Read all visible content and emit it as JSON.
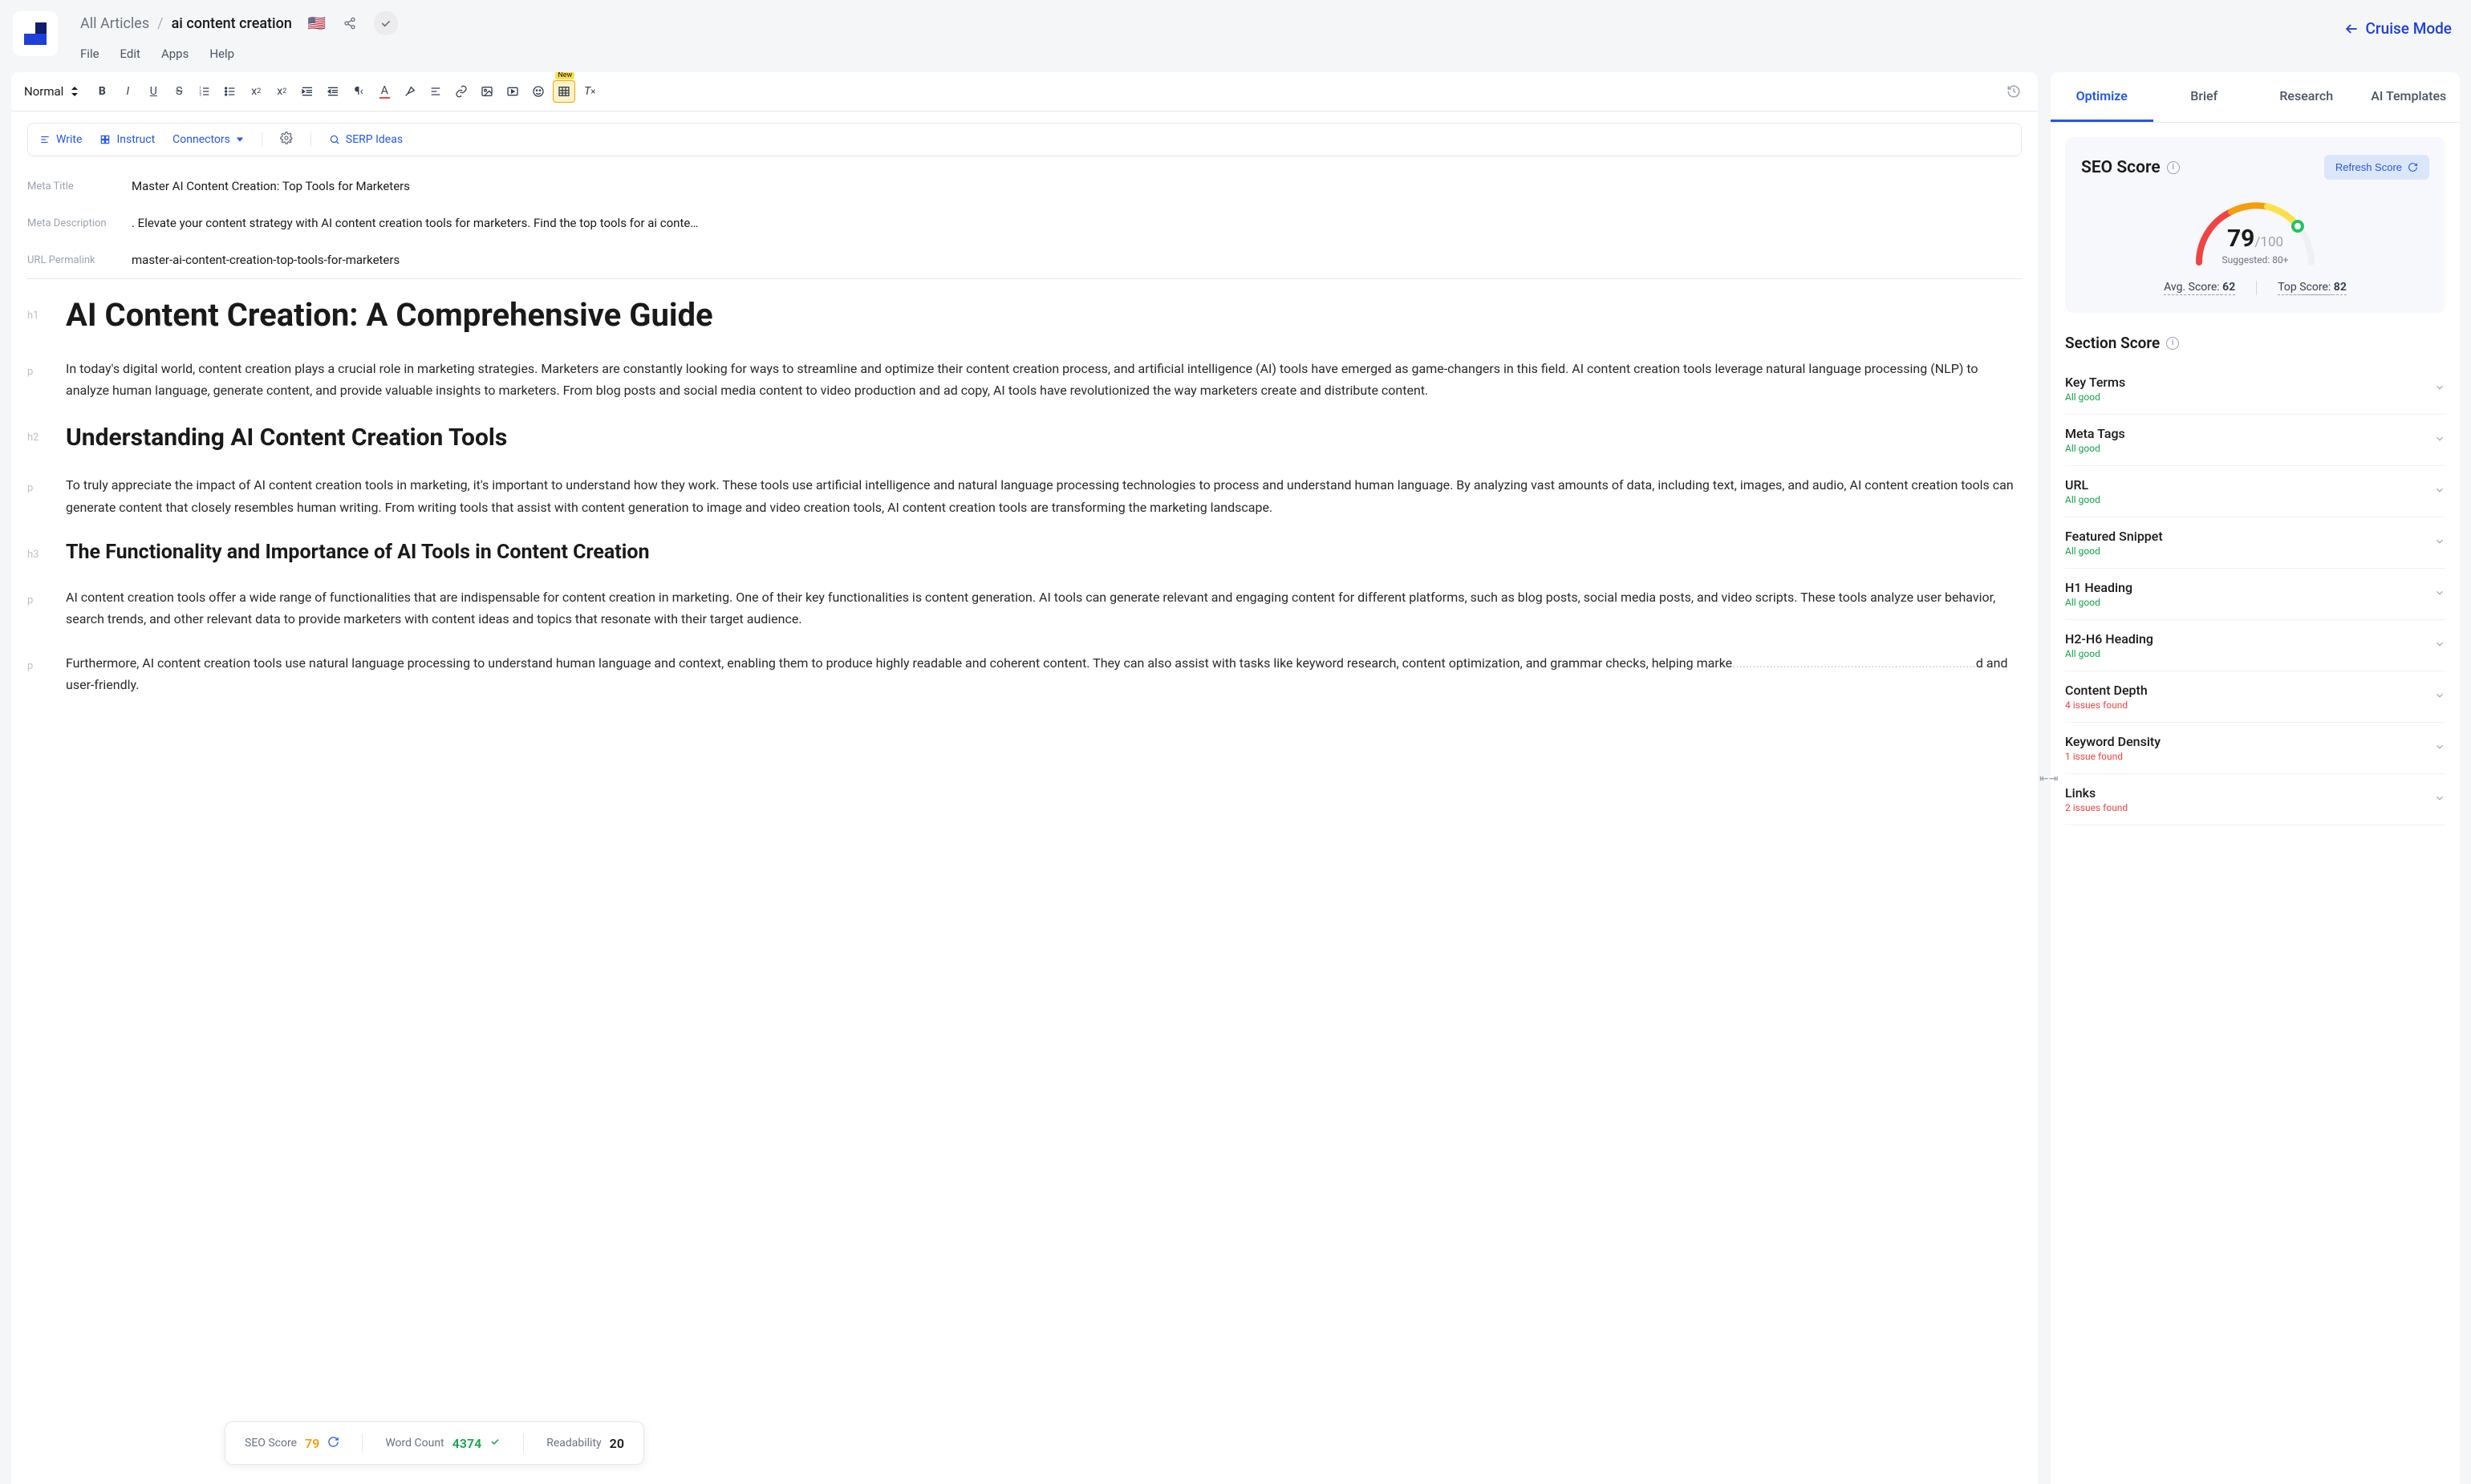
{
  "header": {
    "breadcrumb_root": "All Articles",
    "breadcrumb_leaf": "ai content creation",
    "flag": "🇺🇸",
    "menu": {
      "file": "File",
      "edit": "Edit",
      "apps": "Apps",
      "help": "Help"
    },
    "cruise_mode": "Cruise Mode"
  },
  "toolbar": {
    "style_label": "Normal",
    "new_badge": "New"
  },
  "actions": {
    "write": "Write",
    "instruct": "Instruct",
    "connectors": "Connectors",
    "serp": "SERP Ideas"
  },
  "meta": {
    "title_label": "Meta Title",
    "title_value": "Master AI Content Creation: Top Tools for Marketers",
    "desc_label": "Meta Description",
    "desc_value": ". Elevate your content strategy with AI content creation tools for marketers. Find the top tools for ai conte…",
    "url_label": "URL Permalink",
    "url_value": "master-ai-content-creation-top-tools-for-marketers"
  },
  "doc": {
    "h1": "AI Content Creation: A Comprehensive Guide",
    "p1": "In today's digital world, content creation plays a crucial role in marketing strategies. Marketers are constantly looking for ways to streamline and optimize their content creation process, and artificial intelligence (AI) tools have emerged as game-changers in this field. AI content creation tools leverage natural language processing (NLP) to analyze human language, generate content, and provide valuable insights to marketers. From blog posts and social media content to video production and ad copy, AI tools have revolutionized the way marketers create and distribute content.",
    "h2": "Understanding AI Content Creation Tools",
    "p2": "To truly appreciate the impact of AI content creation tools in marketing, it's important to understand how they work. These tools use artificial intelligence and natural language processing technologies to process and understand human language. By analyzing vast amounts of data, including text, images, and audio, AI content creation tools can generate content that closely resembles human writing. From writing tools that assist with content generation to image and video creation tools, AI content creation tools are transforming the marketing landscape.",
    "h3": "The Functionality and Importance of AI Tools in Content Creation",
    "p3": "AI content creation tools offer a wide range of functionalities that are indispensable for content creation in marketing. One of their key functionalities is content generation. AI tools can generate relevant and engaging content for different platforms, such as blog posts, social media posts, and video scripts. These tools analyze user behavior, search trends, and other relevant data to provide marketers with content ideas and topics that resonate with their target audience.",
    "p4_a": " Furthermore, AI content creation tools use natural language processing to understand human language and context, enabling them to produce highly readable and coherent content. They can also assist with tasks like keyword research, content optimization, and grammar checks, helping marke",
    "p4_b": "d and user-friendly."
  },
  "status": {
    "seo_label": "SEO Score",
    "seo_val": "79",
    "wc_label": "Word Count",
    "wc_val": "4374",
    "read_label": "Readability",
    "read_val": "20"
  },
  "side": {
    "tabs": {
      "optimize": "Optimize",
      "brief": "Brief",
      "research": "Research",
      "ai": "AI Templates"
    },
    "seo_title": "SEO Score",
    "refresh_label": "Refresh Score",
    "score": "79",
    "score_max": "/100",
    "suggested": "Suggested: 80+",
    "avg_label": "Avg. Score: ",
    "avg_val": "62",
    "top_label": "Top Score: ",
    "top_val": "82",
    "section_title": "Section Score",
    "sections": [
      {
        "name": "Key Terms",
        "status": "All good",
        "ok": true
      },
      {
        "name": "Meta Tags",
        "status": "All good",
        "ok": true
      },
      {
        "name": "URL",
        "status": "All good",
        "ok": true
      },
      {
        "name": "Featured Snippet",
        "status": "All good",
        "ok": true
      },
      {
        "name": "H1 Heading",
        "status": "All good",
        "ok": true
      },
      {
        "name": "H2-H6 Heading",
        "status": "All good",
        "ok": true
      },
      {
        "name": "Content Depth",
        "status": "4 issues found",
        "ok": false
      },
      {
        "name": "Keyword Density",
        "status": "1 issue found",
        "ok": false
      },
      {
        "name": "Links",
        "status": "2 issues found",
        "ok": false
      }
    ]
  }
}
